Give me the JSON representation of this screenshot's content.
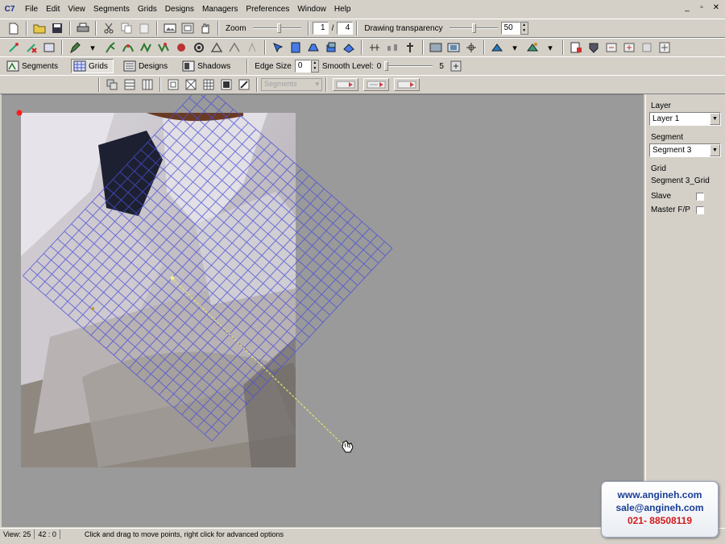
{
  "menu": {
    "items": [
      "File",
      "Edit",
      "View",
      "Segments",
      "Grids",
      "Designs",
      "Managers",
      "Preferences",
      "Window",
      "Help"
    ]
  },
  "toolbar1": {
    "zoom_label": "Zoom",
    "page_current": "1",
    "page_separator": "/",
    "page_total": "4",
    "transparency_label": "Drawing transparency",
    "transparency_value": "50"
  },
  "toolbar3": {
    "tabs": [
      {
        "label": "Segments",
        "icon": "segments-icon"
      },
      {
        "label": "Grids",
        "icon": "grid-icon"
      },
      {
        "label": "Designs",
        "icon": "designs-icon"
      },
      {
        "label": "Shadows",
        "icon": "shadows-icon"
      }
    ],
    "edge_size_label": "Edge Size",
    "edge_size_value": "0",
    "smooth_level_label": "Smooth Level:",
    "smooth_min": "0",
    "smooth_max": "5"
  },
  "toolbar4": {
    "segments_combo": "Segments"
  },
  "panel": {
    "layer_label": "Layer",
    "layer_value": "Layer 1",
    "segment_label": "Segment",
    "segment_value": "Segment 3",
    "grid_label": "Grid",
    "grid_value": "Segment 3_Grid",
    "slave_label": "Slave",
    "master_label": "Master F/P"
  },
  "status": {
    "view_label": "View:",
    "view_value": "25",
    "status_cell_2": "42 : 0",
    "message": "Click and drag to move points, right click for advanced options"
  },
  "watermark": {
    "website": "www.angineh.com",
    "email": "sale@angineh.com",
    "phone": "021- 88508119"
  },
  "colors": {
    "chrome": "#d4d0c8",
    "canvas": "#9a9a9a",
    "grid_lines": "#4a4fd8",
    "guide_line": "#e8e46a",
    "watermark_blue": "#1b3f96",
    "watermark_red": "#d11b1b"
  }
}
